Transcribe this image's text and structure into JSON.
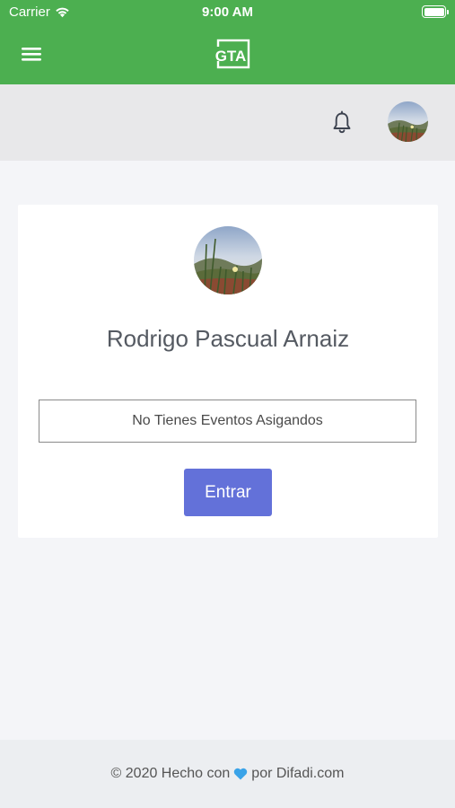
{
  "status_bar": {
    "carrier": "Carrier",
    "time": "9:00 AM",
    "icons": [
      "wifi-icon",
      "battery-icon"
    ]
  },
  "app_bar": {
    "menu_icon": "hamburger-menu-icon",
    "logo_text": "GTA",
    "background_color": "#4caf50"
  },
  "sub_header": {
    "notification_icon": "bell-icon",
    "avatar": "user-avatar"
  },
  "profile_card": {
    "user_name": "Rodrigo Pascual Arnaiz",
    "events_message": "No Tienes Eventos Asigandos",
    "enter_button_label": "Entrar",
    "button_color": "#6371d9"
  },
  "footer": {
    "text_before": "© 2020 Hecho con",
    "heart_icon": "heart-icon",
    "text_after": "por Difadi.com"
  }
}
